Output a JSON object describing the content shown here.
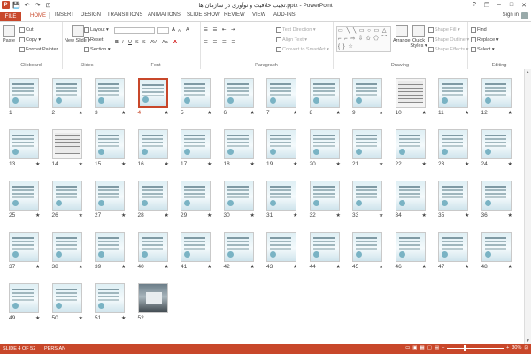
{
  "window": {
    "title": "تجیب خلاقیت و نوآوری در سازمان ها.pptx - PowerPoint"
  },
  "qat": {
    "save": "💾",
    "undo": "↶",
    "redo": "↷",
    "start": "⊡"
  },
  "window_controls": {
    "help": "?",
    "restore": "❐",
    "minimize": "–",
    "maximize": "□",
    "close": "✕"
  },
  "tabs": {
    "file": "FILE",
    "items": [
      "HOME",
      "INSERT",
      "DESIGN",
      "TRANSITIONS",
      "ANIMATIONS",
      "SLIDE SHOW",
      "REVIEW",
      "VIEW",
      "ADD-INS"
    ],
    "active": "HOME"
  },
  "account": {
    "sign_in": "Sign in"
  },
  "ribbon": {
    "clipboard": {
      "label": "Clipboard",
      "paste": "Paste",
      "cut": "Cut",
      "copy": "Copy ▾",
      "format_painter": "Format Painter"
    },
    "slides": {
      "label": "Slides",
      "new_slide": "New Slide ▾",
      "layout": "Layout ▾",
      "reset": "Reset",
      "section": "Section ▾"
    },
    "font": {
      "label": "Font",
      "font_name": "",
      "font_size": "",
      "grow": "A",
      "shrink": "A",
      "clear": "A",
      "bold": "B",
      "italic": "I",
      "underline": "U",
      "strike": "S",
      "shadow": "S",
      "spacing": "AV",
      "case": "Aa",
      "color": "A"
    },
    "paragraph": {
      "label": "Paragraph",
      "text_direction": "Text Direction ▾",
      "align_text": "Align Text ▾",
      "convert_smartart": "Convert to SmartArt ▾"
    },
    "drawing": {
      "label": "Drawing",
      "shapes": "▭ ╲ ╲ ▭ ○ ▭ △ ⌐ ⌐ ⇨ ⇩ ✩ ⬠ ⌒ { } ☆",
      "arrange": "Arrange",
      "quick_styles": "Quick Styles ▾",
      "shape_fill": "Shape Fill ▾",
      "shape_outline": "Shape Outline ▾",
      "shape_effects": "Shape Effects ▾"
    },
    "editing": {
      "label": "Editing",
      "find": "Find",
      "replace": "Replace ▾",
      "select": "Select ▾"
    }
  },
  "slides": [
    {
      "n": "1",
      "star": ""
    },
    {
      "n": "2",
      "star": "★"
    },
    {
      "n": "3",
      "star": "★"
    },
    {
      "n": "4",
      "star": "★"
    },
    {
      "n": "5",
      "star": "★"
    },
    {
      "n": "6",
      "star": "★"
    },
    {
      "n": "7",
      "star": "★"
    },
    {
      "n": "8",
      "star": "★"
    },
    {
      "n": "9",
      "star": "★"
    },
    {
      "n": "10",
      "star": "★"
    },
    {
      "n": "11",
      "star": "★"
    },
    {
      "n": "12",
      "star": "★"
    },
    {
      "n": "13",
      "star": "★"
    },
    {
      "n": "14",
      "star": "★"
    },
    {
      "n": "15",
      "star": "★"
    },
    {
      "n": "16",
      "star": "★"
    },
    {
      "n": "17",
      "star": "★"
    },
    {
      "n": "18",
      "star": "★"
    },
    {
      "n": "19",
      "star": "★"
    },
    {
      "n": "20",
      "star": "★"
    },
    {
      "n": "21",
      "star": "★"
    },
    {
      "n": "22",
      "star": "★"
    },
    {
      "n": "23",
      "star": "★"
    },
    {
      "n": "24",
      "star": "★"
    },
    {
      "n": "25",
      "star": "★"
    },
    {
      "n": "26",
      "star": "★"
    },
    {
      "n": "27",
      "star": "★"
    },
    {
      "n": "28",
      "star": "★"
    },
    {
      "n": "29",
      "star": "★"
    },
    {
      "n": "30",
      "star": "★"
    },
    {
      "n": "31",
      "star": "★"
    },
    {
      "n": "32",
      "star": "★"
    },
    {
      "n": "33",
      "star": "★"
    },
    {
      "n": "34",
      "star": "★"
    },
    {
      "n": "35",
      "star": "★"
    },
    {
      "n": "36",
      "star": "★"
    },
    {
      "n": "37",
      "star": "★"
    },
    {
      "n": "38",
      "star": "★"
    },
    {
      "n": "39",
      "star": "★"
    },
    {
      "n": "40",
      "star": "★"
    },
    {
      "n": "41",
      "star": "★"
    },
    {
      "n": "42",
      "star": "★"
    },
    {
      "n": "43",
      "star": "★"
    },
    {
      "n": "44",
      "star": "★"
    },
    {
      "n": "45",
      "star": "★"
    },
    {
      "n": "46",
      "star": "★"
    },
    {
      "n": "47",
      "star": "★"
    },
    {
      "n": "48",
      "star": "★"
    },
    {
      "n": "49",
      "star": "★"
    },
    {
      "n": "50",
      "star": "★"
    },
    {
      "n": "51",
      "star": "★"
    },
    {
      "n": "52",
      "star": ""
    }
  ],
  "selected_slide": "4",
  "status": {
    "slide_info": "SLIDE 4 OF 52",
    "language": "PERSIAN",
    "zoom": "30%",
    "zoom_out": "–",
    "zoom_in": "+",
    "zoom_level": 0.3,
    "fit": "⊡"
  }
}
